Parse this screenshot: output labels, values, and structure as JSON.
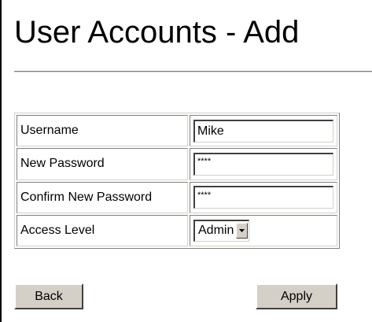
{
  "page": {
    "title": "User Accounts - Add"
  },
  "form": {
    "rows": [
      {
        "label": "Username",
        "type": "text",
        "value": "Mike"
      },
      {
        "label": "New Password",
        "type": "password",
        "value": "****"
      },
      {
        "label": "Confirm New Password",
        "type": "password",
        "value": "****"
      },
      {
        "label": "Access Level",
        "type": "select",
        "value": "Admin"
      }
    ]
  },
  "buttons": {
    "back_label": "Back",
    "apply_label": "Apply"
  },
  "icons": {
    "select_arrow": "chevron-down-icon"
  },
  "colors": {
    "button_face": "#d4d0c8",
    "shadow": "#808080",
    "dark_shadow": "#404040"
  }
}
